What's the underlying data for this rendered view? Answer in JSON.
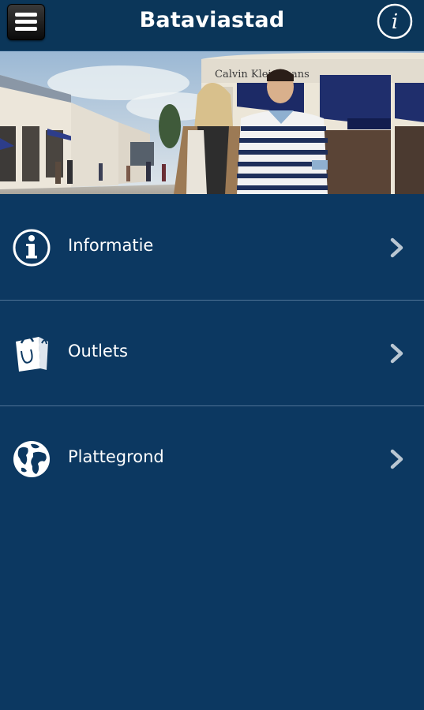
{
  "header": {
    "title": "Bataviastad",
    "menu_icon": "hamburger-menu-icon",
    "info_icon": "info-circle-icon"
  },
  "hero": {
    "store_sign": "Calvin Klein Jeans"
  },
  "menu": {
    "items": [
      {
        "label": "Informatie",
        "icon": "info-circle-icon"
      },
      {
        "label": "Outlets",
        "icon": "shopping-bag-icon"
      },
      {
        "label": "Plattegrond",
        "icon": "globe-icon"
      }
    ]
  },
  "colors": {
    "background": "#0c3861",
    "header": "#0b3659",
    "divider": "#4f7396",
    "text": "#ffffff",
    "chevron": "#b9c6d2"
  }
}
